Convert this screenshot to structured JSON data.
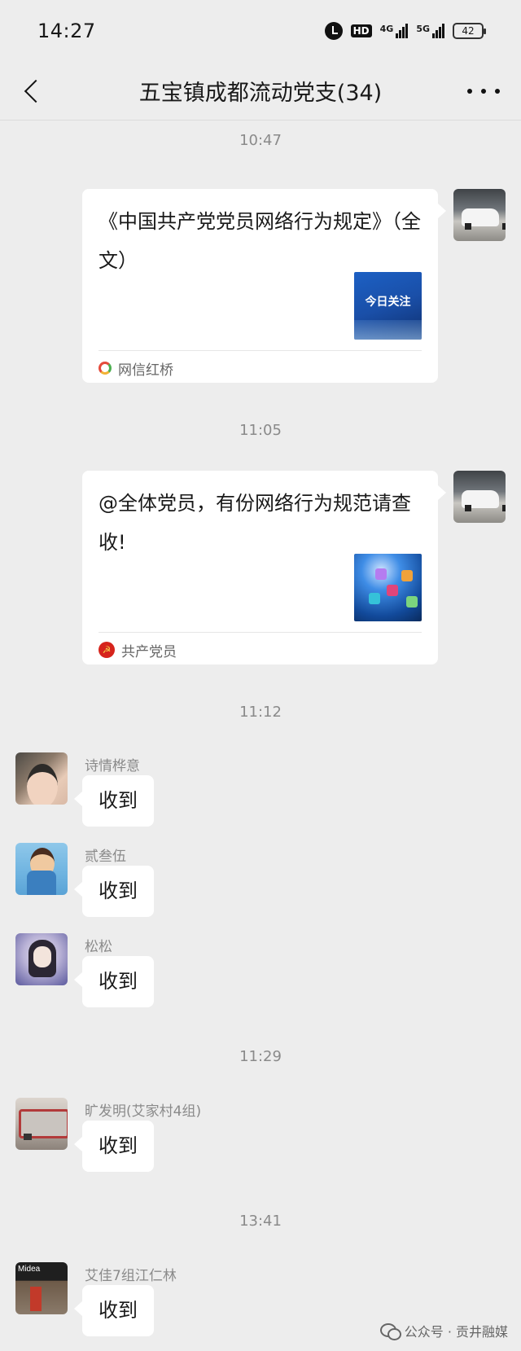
{
  "status_bar": {
    "time": "14:27",
    "hd_label": "HD",
    "network_1": "4G",
    "network_2": "5G",
    "battery": "42"
  },
  "header": {
    "title": "五宝镇成都流动党支(34)"
  },
  "messages": [
    {
      "timestamp": "10:47",
      "card_title": "《中国共产党党员网络行为规定》（全文）",
      "thumb_text": "今日关注",
      "source": "网信红桥"
    },
    {
      "timestamp": "11:05",
      "card_title": "@全体党员，有份网络行为规范请查收!",
      "source": "共产党员"
    },
    {
      "timestamp": "11:12",
      "replies": [
        {
          "sender": "诗情桦意",
          "text": "收到"
        },
        {
          "sender": "贰叁伍",
          "text": "收到"
        },
        {
          "sender": "松松",
          "text": "收到"
        }
      ]
    },
    {
      "timestamp": "11:29",
      "replies": [
        {
          "sender": "旷发明(艾家村4组)",
          "text": "收到"
        }
      ]
    },
    {
      "timestamp": "13:41",
      "replies": [
        {
          "sender": "艾佳7组江仁林",
          "text": "收到"
        }
      ]
    }
  ],
  "watermark": {
    "text": "公众号 · 贡井融媒"
  }
}
